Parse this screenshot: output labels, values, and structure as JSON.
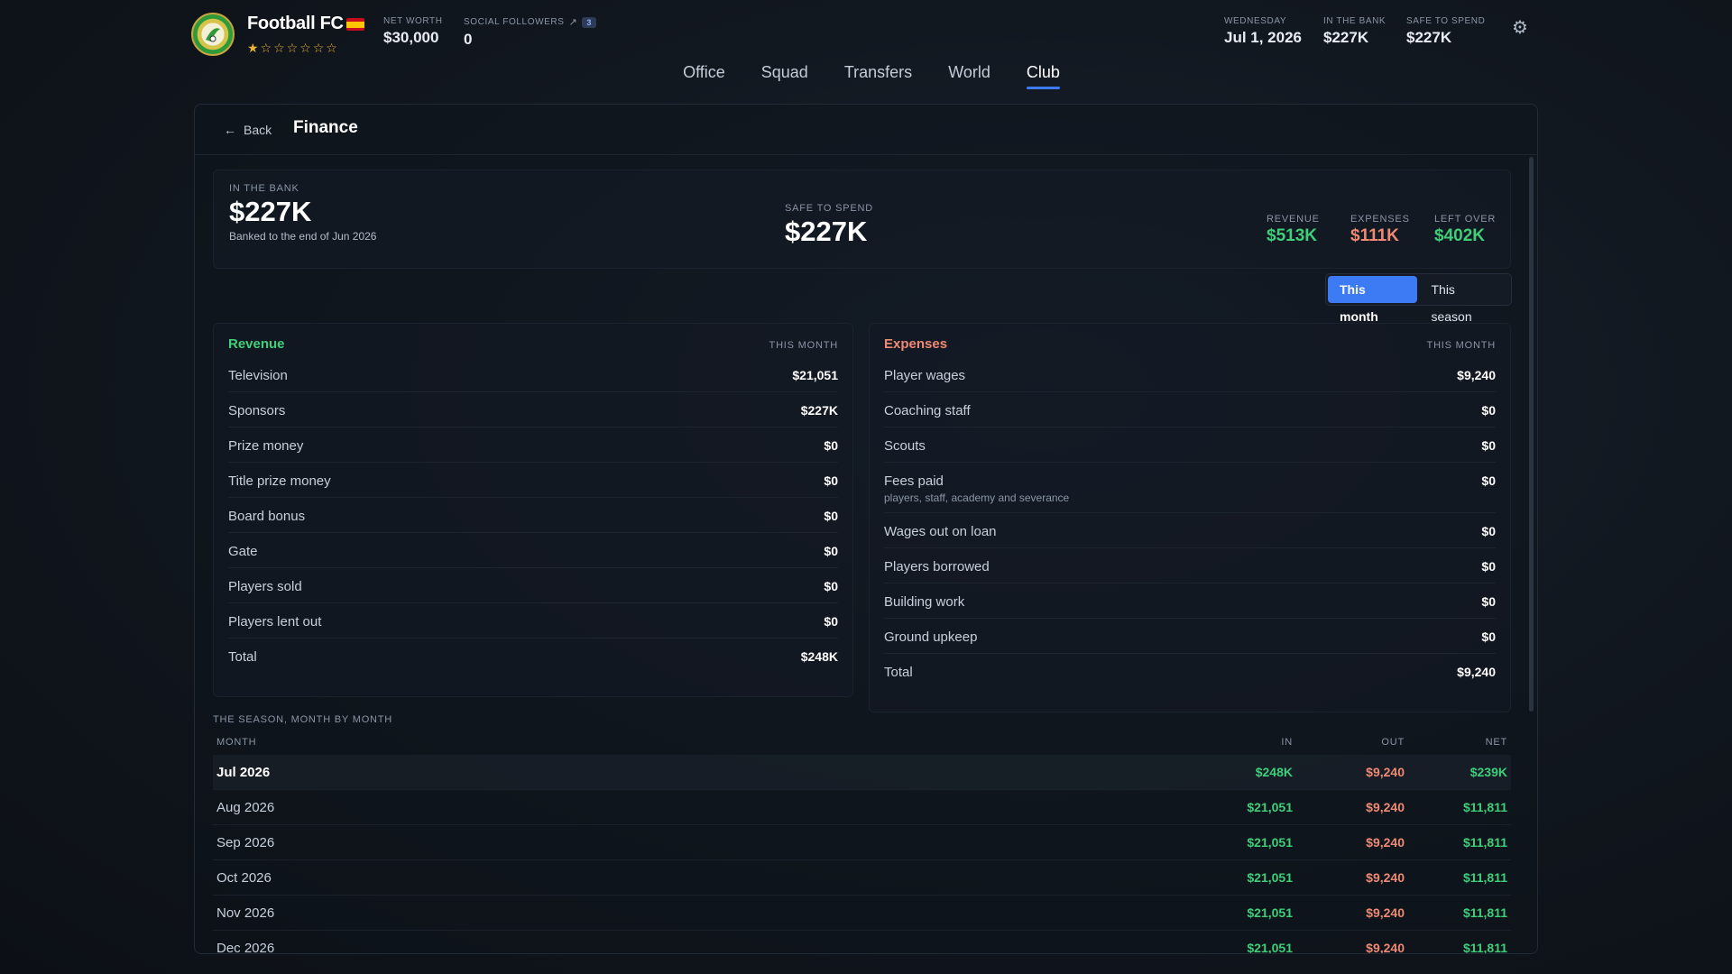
{
  "club": {
    "name": "Football FC",
    "stars": "★☆☆☆☆☆☆",
    "net_worth_label": "NET WORTH",
    "net_worth": "$30,000",
    "followers_label": "SOCIAL FOLLOWERS",
    "followers_badge": "3",
    "followers": "0"
  },
  "status": {
    "day_label": "WEDNESDAY",
    "date": "Jul 1, 2026",
    "bank_label": "IN THE BANK",
    "bank": "$227K",
    "safe_label": "SAFE TO SPEND",
    "safe": "$227K"
  },
  "nav": {
    "office": "Office",
    "squad": "Squad",
    "transfers": "Transfers",
    "world": "World",
    "club": "Club"
  },
  "page": {
    "back": "Back",
    "title": "Finance"
  },
  "summary": {
    "bank_label": "IN THE BANK",
    "bank": "$227K",
    "bank_sub": "Banked to the end of Jun 2026",
    "safe_label": "SAFE TO SPEND",
    "safe": "$227K",
    "revenue_label": "REVENUE",
    "revenue": "$513K",
    "expenses_label": "EXPENSES",
    "expenses": "$111K",
    "leftover_label": "LEFT OVER",
    "leftover": "$402K"
  },
  "toggle": {
    "month": "This month",
    "season": "This season"
  },
  "revenue": {
    "title": "Revenue",
    "period": "THIS MONTH",
    "rows": [
      {
        "k": "Television",
        "v": "$21,051"
      },
      {
        "k": "Sponsors",
        "v": "$227K"
      },
      {
        "k": "Prize money",
        "v": "$0"
      },
      {
        "k": "Title prize money",
        "v": "$0"
      },
      {
        "k": "Board bonus",
        "v": "$0"
      },
      {
        "k": "Gate",
        "v": "$0"
      },
      {
        "k": "Players sold",
        "v": "$0"
      },
      {
        "k": "Players lent out",
        "v": "$0"
      }
    ],
    "total_label": "Total",
    "total": "$248K"
  },
  "expenses": {
    "title": "Expenses",
    "period": "THIS MONTH",
    "rows": [
      {
        "k": "Player wages",
        "v": "$9,240"
      },
      {
        "k": "Coaching staff",
        "v": "$0"
      },
      {
        "k": "Scouts",
        "v": "$0"
      },
      {
        "k": "Fees paid",
        "v": "$0",
        "s": "players, staff, academy and severance"
      },
      {
        "k": "Wages out on loan",
        "v": "$0"
      },
      {
        "k": "Players borrowed",
        "v": "$0"
      },
      {
        "k": "Building work",
        "v": "$0"
      },
      {
        "k": "Ground upkeep",
        "v": "$0"
      }
    ],
    "total_label": "Total",
    "total": "$9,240"
  },
  "season": {
    "label": "THE SEASON, MONTH BY MONTH",
    "col_month": "MONTH",
    "col_in": "IN",
    "col_out": "OUT",
    "col_net": "NET",
    "rows": [
      {
        "m": "Jul 2026",
        "in": "$248K",
        "out": "$9,240",
        "net": "$239K"
      },
      {
        "m": "Aug 2026",
        "in": "$21,051",
        "out": "$9,240",
        "net": "$11,811"
      },
      {
        "m": "Sep 2026",
        "in": "$21,051",
        "out": "$9,240",
        "net": "$11,811"
      },
      {
        "m": "Oct 2026",
        "in": "$21,051",
        "out": "$9,240",
        "net": "$11,811"
      },
      {
        "m": "Nov 2026",
        "in": "$21,051",
        "out": "$9,240",
        "net": "$11,811"
      },
      {
        "m": "Dec 2026",
        "in": "$21,051",
        "out": "$9,240",
        "net": "$11,811"
      }
    ]
  },
  "colors": {
    "accent": "#3d7bf4",
    "positive": "#3fce7a",
    "negative": "#ee8a73"
  },
  "icons": {
    "settings": "gear-icon",
    "back": "arrow-left-icon",
    "external": "external-link-icon"
  }
}
